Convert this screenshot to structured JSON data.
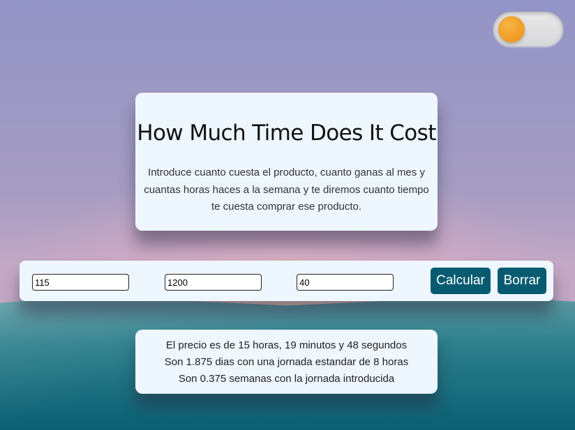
{
  "theme_toggle": {
    "state": "off",
    "knob_color": "#EE9A24"
  },
  "intro": {
    "title": "How Much Time Does It Cost",
    "description": "Introduce cuanto cuesta el producto, cuanto ganas al mes y cuantas horas haces a la semana y te diremos cuanto tiempo te cuesta comprar ese producto."
  },
  "form": {
    "price_value": "115",
    "salary_value": "1200",
    "hours_value": "40",
    "calculate_label": "Calcular",
    "clear_label": "Borrar",
    "button_color": "#075B71"
  },
  "result": {
    "lines": [
      "El precio es de 15 horas, 19 minutos y 48 segundos",
      "Son 1.875 dias con una jornada estandar de 8 horas",
      "Son 0.375 semanas con la jornada introducida"
    ]
  },
  "colors": {
    "sky_top": "#9394C6",
    "glow": "#E8C4B4",
    "hill": "#2D7F8C",
    "card_bg": "#EEF6FE"
  }
}
